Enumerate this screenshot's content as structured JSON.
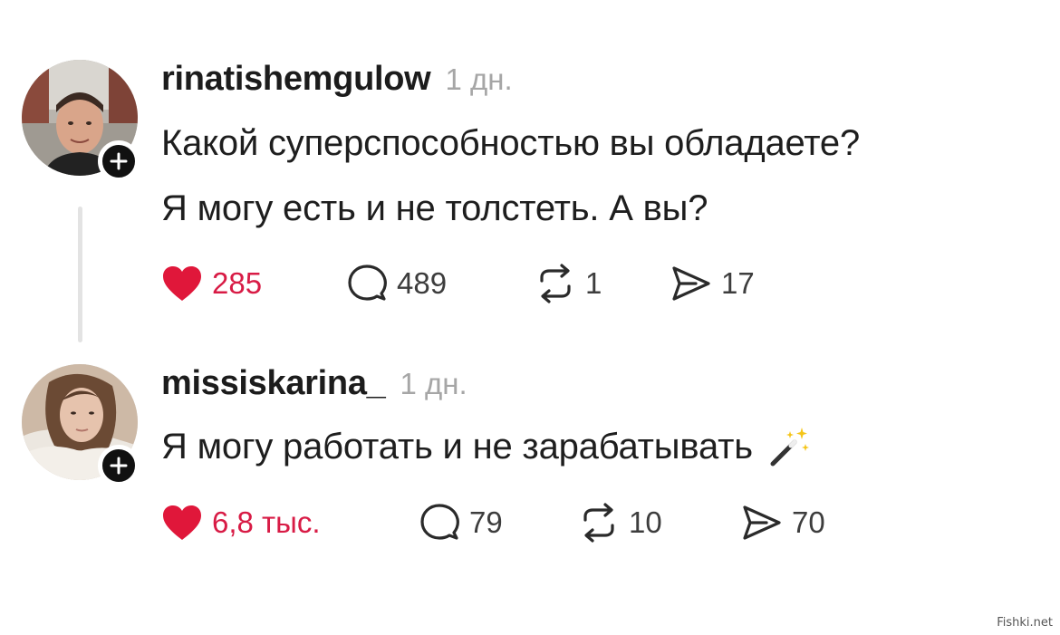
{
  "posts": [
    {
      "username": "rinatishemgulow",
      "time": "1 дн.",
      "lines": [
        "Какой суперспособностью вы обладаете?",
        "Я могу есть и не толстеть. А вы?"
      ],
      "likes": "285",
      "replies": "489",
      "reposts": "1",
      "shares": "17",
      "liked": true
    },
    {
      "username": "missiskarina_",
      "time": "1 дн.",
      "lines": [
        "Я могу работать и не зарабатывать"
      ],
      "emoji_icon": "magic-wand-emoji",
      "likes": "6,8 тыс.",
      "replies": "79",
      "reposts": "10",
      "shares": "70",
      "liked": true
    }
  ],
  "watermark": "Fishki.net",
  "colors": {
    "like": "#e0173a",
    "like_count": "#d81b45",
    "muted": "#a6a6a6",
    "text": "#1e1e1e"
  }
}
